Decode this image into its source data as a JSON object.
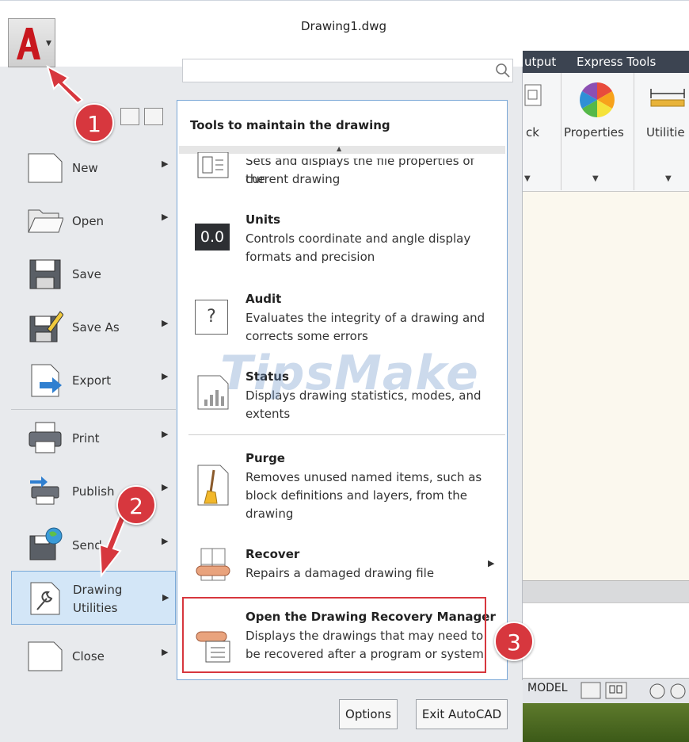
{
  "window": {
    "title": "Drawing1.dwg"
  },
  "ribbon": {
    "tabs": [
      "utput",
      "Express Tools"
    ],
    "panels": [
      {
        "label": "ck"
      },
      {
        "label": "Properties"
      },
      {
        "label": "Utilitie"
      }
    ]
  },
  "status_bar": {
    "model_label": "MODEL"
  },
  "menu": {
    "items": [
      {
        "label": "New",
        "has_arrow": true
      },
      {
        "label": "Open",
        "has_arrow": true
      },
      {
        "label": "Save",
        "has_arrow": false
      },
      {
        "label": "Save As",
        "has_arrow": true
      },
      {
        "label": "Export",
        "has_arrow": true
      },
      {
        "label": "Print",
        "has_arrow": true
      },
      {
        "label": "Publish",
        "has_arrow": true
      },
      {
        "label": "Send",
        "has_arrow": true
      },
      {
        "label_line1": "Drawing",
        "label_line2": "Utilities",
        "has_arrow": true,
        "selected": true
      },
      {
        "label": "Close",
        "has_arrow": true
      }
    ]
  },
  "submenu": {
    "header": "Tools to maintain the drawing",
    "items": [
      {
        "title": "",
        "desc1": "Sets and displays the file properties of the",
        "desc2": "current drawing"
      },
      {
        "title": "Units",
        "icon_text": "0.0",
        "desc1": "Controls coordinate and angle display",
        "desc2": "formats and precision"
      },
      {
        "title": "Audit",
        "icon_text": "?",
        "desc1": "Evaluates the integrity of a drawing and",
        "desc2": "corrects some errors"
      },
      {
        "title": "Status",
        "desc1": "Displays drawing statistics, modes, and",
        "desc2": "extents"
      },
      {
        "title": "Purge",
        "desc1": "Removes unused named items, such as",
        "desc2": "block definitions and layers, from the",
        "desc3": "drawing"
      },
      {
        "title": "Recover",
        "desc1": "Repairs a damaged drawing file"
      },
      {
        "title": "Open the Drawing Recovery Manager",
        "desc1": "Displays the drawings that may need to",
        "desc2": "be recovered after a program or system"
      }
    ]
  },
  "bottom": {
    "options_label": "Options",
    "exit_label": "Exit AutoCAD"
  },
  "watermark": "TipsMake",
  "callouts": [
    "1",
    "2",
    "3"
  ],
  "colors": {
    "callout": "#d7373e",
    "ribbon_tab_bg": "#3c4451",
    "selection_bg": "#d3e6f7"
  }
}
